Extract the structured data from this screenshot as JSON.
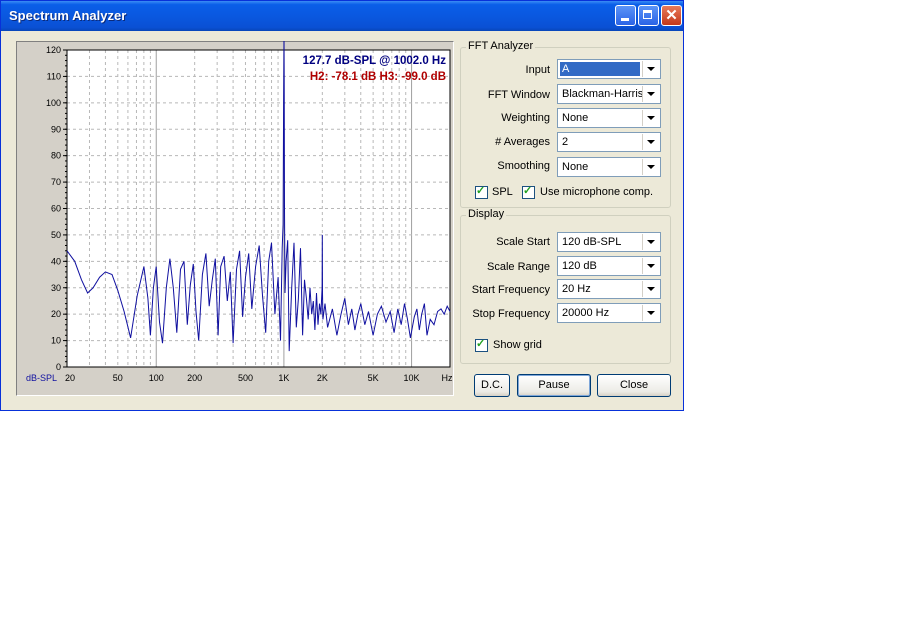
{
  "window": {
    "title": "Spectrum Analyzer"
  },
  "colors": {
    "title_bar": "#0a58e0",
    "trace": "#1010a0",
    "readout_main": "#000080",
    "readout_harmonics": "#b00000",
    "plot_bg": "#ffffff",
    "selection": "#316ac5"
  },
  "fft": {
    "group_title": "FFT Analyzer",
    "input": {
      "label": "Input",
      "value": "A"
    },
    "fft_window": {
      "label": "FFT Window",
      "value": "Blackman-Harris"
    },
    "weighting": {
      "label": "Weighting",
      "value": "None"
    },
    "averages": {
      "label": "# Averages",
      "value": "2"
    },
    "smoothing": {
      "label": "Smoothing",
      "value": "None"
    },
    "spl": {
      "label": "SPL",
      "checked": true
    },
    "mic_comp": {
      "label": "Use microphone comp.",
      "checked": true
    }
  },
  "display": {
    "group_title": "Display",
    "scale_start": {
      "label": "Scale Start",
      "value": "120 dB-SPL"
    },
    "scale_range": {
      "label": "Scale Range",
      "value": "120 dB"
    },
    "start_frequency": {
      "label": "Start Frequency",
      "value": "20 Hz"
    },
    "stop_frequency": {
      "label": "Stop Frequency",
      "value": "20000 Hz"
    },
    "show_grid": {
      "label": "Show grid",
      "checked": true
    }
  },
  "buttons": {
    "dc": "D.C.",
    "pause": "Pause",
    "close": "Close"
  },
  "chart_data": {
    "type": "line",
    "readout": "127.7 dB-SPL @ 1002.0 Hz",
    "harmonics": "H2: -78.1 dB  H3: -99.0 dB",
    "ylabel": "dB-SPL",
    "xunit": "Hz",
    "x_scale": "log",
    "xlim": [
      20,
      20000
    ],
    "ylim": [
      0,
      120
    ],
    "yticks": [
      "0",
      "10",
      "20",
      "30",
      "40",
      "50",
      "60",
      "70",
      "80",
      "90",
      "100",
      "110",
      "120"
    ],
    "xticks": [
      {
        "v": 20,
        "label": "20"
      },
      {
        "v": 50,
        "label": "50"
      },
      {
        "v": 100,
        "label": "100"
      },
      {
        "v": 200,
        "label": "200"
      },
      {
        "v": 500,
        "label": "500"
      },
      {
        "v": 1000,
        "label": "1K"
      },
      {
        "v": 2000,
        "label": "2K"
      },
      {
        "v": 5000,
        "label": "5K"
      },
      {
        "v": 10000,
        "label": "10K"
      }
    ],
    "grid": true,
    "series": [
      {
        "x": [
          20,
          23,
          26,
          29,
          32,
          36,
          40,
          45,
          50,
          56,
          63,
          71,
          80,
          86,
          90,
          95,
          100,
          106,
          112,
          120,
          128,
          136,
          145,
          155,
          165,
          175,
          185,
          195,
          205,
          215,
          230,
          245,
          260,
          275,
          290,
          305,
          320,
          340,
          360,
          380,
          400,
          425,
          450,
          475,
          500,
          530,
          560,
          600,
          640,
          680,
          720,
          760,
          800,
          850,
          900,
          940,
          970,
          985,
          995,
          1000,
          1002,
          1005,
          1010,
          1020,
          1040,
          1070,
          1100,
          1150,
          1200,
          1250,
          1300,
          1350,
          1400,
          1450,
          1500,
          1550,
          1600,
          1650,
          1700,
          1750,
          1800,
          1850,
          1900,
          1950,
          1990,
          2000,
          2005,
          2020,
          2100,
          2200,
          2400,
          2600,
          2800,
          3000,
          3200,
          3400,
          3600,
          3800,
          4000,
          4300,
          4600,
          5000,
          5400,
          5800,
          6300,
          6800,
          7300,
          7800,
          8300,
          8800,
          9300,
          9800,
          10500,
          11000,
          11500,
          12000,
          12600,
          13200,
          14000,
          15000,
          16000,
          17000,
          18000,
          19000,
          20000
        ],
        "y": [
          44,
          40,
          33,
          28,
          30,
          34,
          36,
          35,
          29,
          21,
          11,
          27,
          38,
          26,
          12,
          30,
          38,
          17,
          9,
          30,
          41,
          30,
          13,
          37,
          40,
          16,
          31,
          39,
          21,
          10,
          35,
          43,
          23,
          33,
          41,
          12,
          38,
          42,
          25,
          36,
          9,
          37,
          44,
          19,
          34,
          43,
          22,
          38,
          46,
          27,
          13,
          40,
          47,
          20,
          34,
          10,
          45,
          54,
          100,
          119,
          127,
          110,
          60,
          28,
          40,
          48,
          6,
          30,
          47,
          15,
          26,
          45,
          12,
          33,
          26,
          18,
          30,
          20,
          25,
          14,
          28,
          16,
          24,
          20,
          30,
          50,
          28,
          18,
          24,
          15,
          22,
          12,
          20,
          26,
          16,
          22,
          14,
          20,
          24,
          16,
          21,
          12,
          20,
          23,
          17,
          21,
          13,
          22,
          16,
          24,
          18,
          11,
          19,
          22,
          14,
          20,
          24,
          12,
          18,
          16,
          21,
          22,
          20,
          23,
          21
        ]
      }
    ]
  }
}
